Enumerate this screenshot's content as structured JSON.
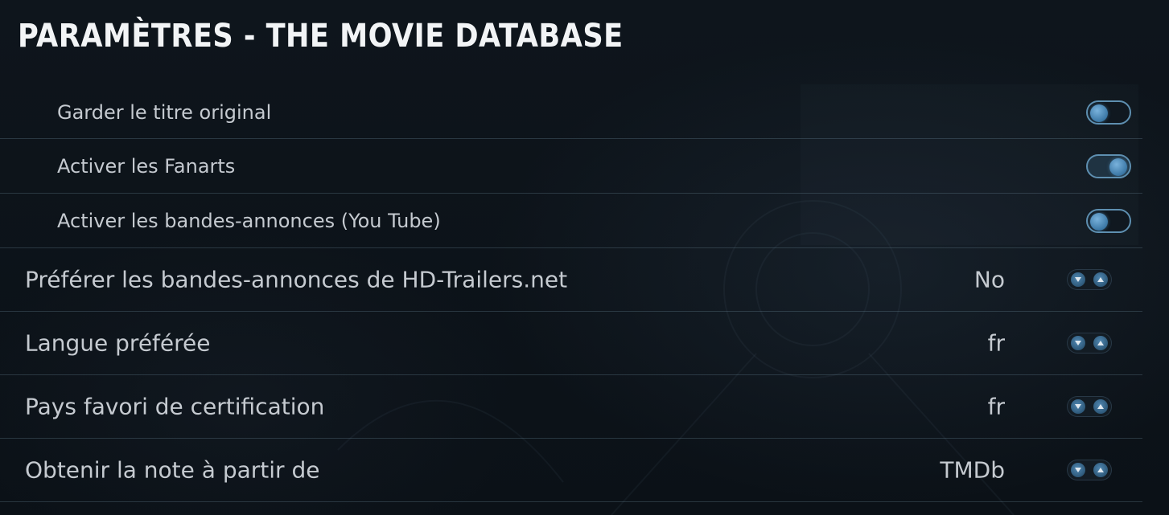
{
  "header": {
    "title": "PARAMÈTRES - THE MOVIE DATABASE"
  },
  "settings": {
    "sub": [
      {
        "label": "Garder le titre original",
        "enabled": false
      },
      {
        "label": "Activer les Fanarts",
        "enabled": true
      },
      {
        "label": "Activer les bandes-annonces (You Tube)",
        "enabled": false
      }
    ],
    "main": [
      {
        "label": "Préférer les bandes-annonces de HD-Trailers.net",
        "value": "No"
      },
      {
        "label": "Langue préférée",
        "value": "fr"
      },
      {
        "label": "Pays favori de certification",
        "value": "fr"
      },
      {
        "label": "Obtenir la note à partir de",
        "value": "TMDb"
      }
    ]
  },
  "icons": {
    "spinner_down": "chevron-down-icon",
    "spinner_up": "chevron-up-icon"
  },
  "colors": {
    "accent": "#5e8fb0",
    "knob": "#3c78a6",
    "background": "#0d141b",
    "title": "#f2f4f6",
    "text": "#c5cad0"
  }
}
